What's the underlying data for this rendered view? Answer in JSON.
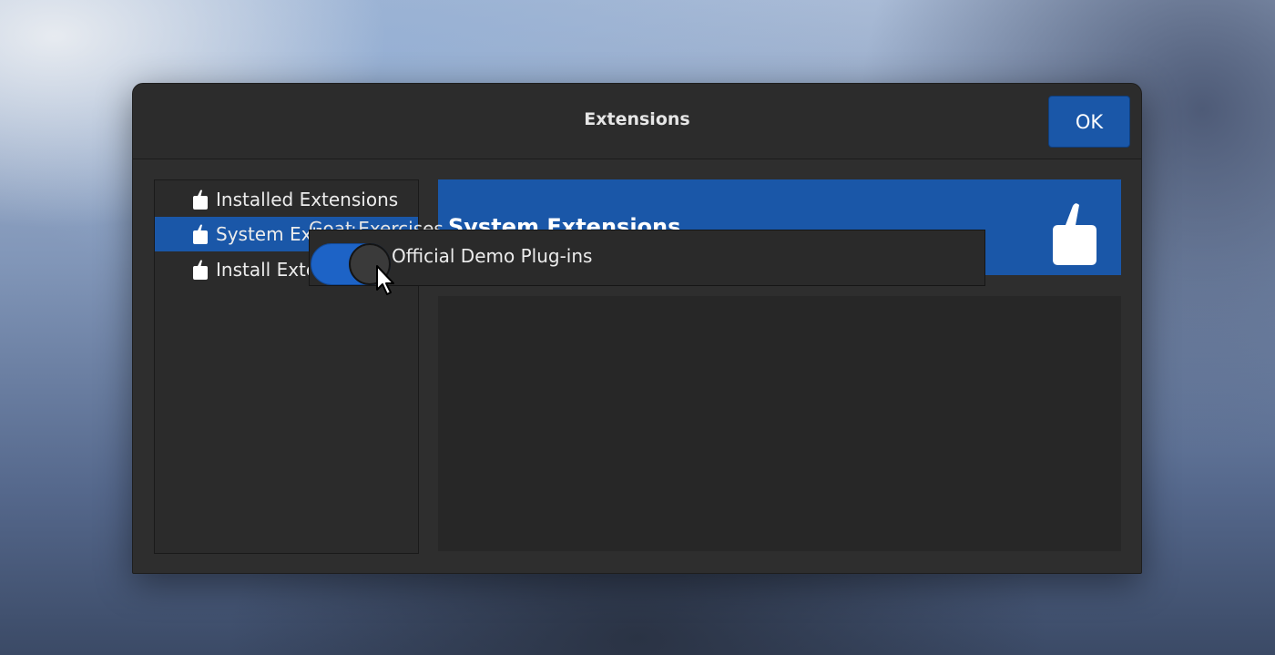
{
  "dialog": {
    "title": "Extensions",
    "ok_label": "OK"
  },
  "sidebar": {
    "items": [
      {
        "label": "Installed Extensions",
        "icon": "extension-icon",
        "selected": false
      },
      {
        "label": "System Extensions",
        "icon": "extension-icon",
        "selected": true
      },
      {
        "label": "Install Extensions",
        "icon": "extension-icon",
        "selected": false
      }
    ]
  },
  "main": {
    "header_title": "System Extensions",
    "header_icon": "extension-icon",
    "group_title": "Goat Exercises",
    "toggle": {
      "label": "Official Demo Plug-ins",
      "on": true
    }
  },
  "colors": {
    "accent": "#1a57a8",
    "window_bg": "#2e2e2e",
    "text": "#ececec"
  }
}
